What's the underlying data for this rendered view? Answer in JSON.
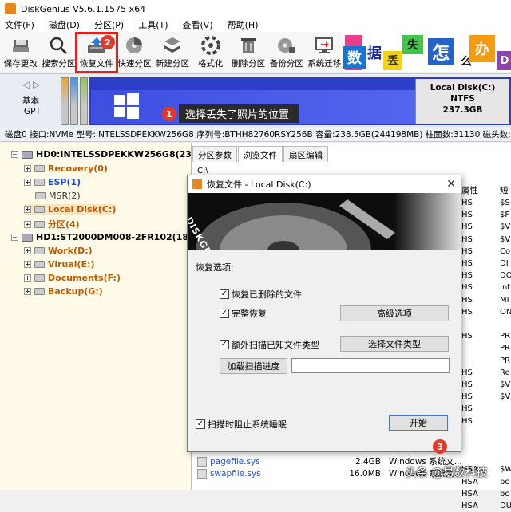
{
  "window": {
    "title": "DiskGenius V5.6.1.1575 x64"
  },
  "menu": [
    "文件(F)",
    "磁盘(D)",
    "分区(P)",
    "工具(T)",
    "查看(V)",
    "帮助(H)"
  ],
  "toolbar": {
    "items": [
      {
        "label": "保存更改",
        "icon": "save-icon"
      },
      {
        "label": "搜索分区",
        "icon": "search-icon"
      },
      {
        "label": "恢复文件",
        "icon": "recover-icon"
      },
      {
        "label": "快速分区",
        "icon": "quick-partition-icon"
      },
      {
        "label": "新建分区",
        "icon": "new-partition-icon"
      },
      {
        "label": "格式化",
        "icon": "format-icon"
      },
      {
        "label": "删除分区",
        "icon": "delete-icon"
      },
      {
        "label": "备份分区",
        "icon": "backup-icon"
      },
      {
        "label": "系统迁移",
        "icon": "migrate-icon"
      }
    ]
  },
  "ad": {
    "tiles": [
      "数",
      "据",
      "丢",
      "失",
      "怎",
      "么",
      "办",
      "D"
    ]
  },
  "badges": {
    "one": "1",
    "two": "2",
    "three": "3"
  },
  "diskbar": {
    "basic": "基本",
    "gpt": "GPT",
    "callout": "选择丢失了照片的位置",
    "disk_name": "Local Disk(C:)",
    "fs": "NTFS",
    "size": "237.3GB"
  },
  "diskinfo": "磁盘0 接口:NVMe  型号:INTELSSDPEKKW256G8  序列号:BTHH82760RSY256B  容量:238.5GB(244198MB)  柱面数:31130  磁头数:",
  "tree": {
    "hd0": "HD0:INTELSSDPEKKW256G8(238GB)",
    "hd0_parts": [
      "Recovery(0)",
      "ESP(1)",
      "MSR(2)",
      "Local Disk(C:)",
      "分区(4)"
    ],
    "hd1": "HD1:ST2000DM008-2FR102(1863GB)",
    "hd1_parts": [
      "Work(D:)",
      "Virual(E:)",
      "Documents(F:)",
      "Backup(G:)"
    ]
  },
  "tabs": [
    "分区参数",
    "浏览文件",
    "扇区编辑"
  ],
  "file_pane": {
    "path": "C:\\",
    "col_attr": "属性",
    "col_short": "短",
    "attr_col": [
      "HS",
      "HS",
      "HS",
      "HS",
      "HS",
      "HS",
      "HS",
      "HS",
      "HS",
      "HS",
      "",
      "HS",
      "",
      "",
      "HS",
      "HS",
      "HS",
      "HS",
      "HS",
      "",
      "",
      "",
      "HSA",
      "HSA",
      "HSA",
      "HSA"
    ],
    "short_col": [
      "$S",
      "$F",
      "$V",
      "$V",
      "Co",
      "DI",
      "DO",
      "Int",
      "MI",
      "ON",
      "",
      "PR",
      "PR",
      "PR",
      "Re",
      "$V",
      "$V",
      "",
      "",
      "",
      "",
      "",
      "$W",
      "bc",
      "bc",
      "DU"
    ],
    "files": [
      {
        "name": "pagefile.sys",
        "size": "2.4GB",
        "type": "Windows 系统文..."
      },
      {
        "name": "swapfile.sys",
        "size": "16.0MB",
        "type": "Windows 系统文..."
      }
    ]
  },
  "dialog": {
    "title": "恢复文件 - Local Disk(C:)",
    "brand": "DISKGENIUS",
    "options_label": "恢复选项:",
    "chk_deleted": "恢复已删除的文件",
    "chk_complete": "完整恢复",
    "btn_advanced": "高级选项",
    "chk_extra": "额外扫描已知文件类型",
    "btn_filetype": "选择文件类型",
    "btn_load": "加载扫描进度",
    "chk_sleep": "扫描时阻止系统睡眠",
    "btn_start": "开始"
  },
  "watermark": "头条 @易数科技"
}
